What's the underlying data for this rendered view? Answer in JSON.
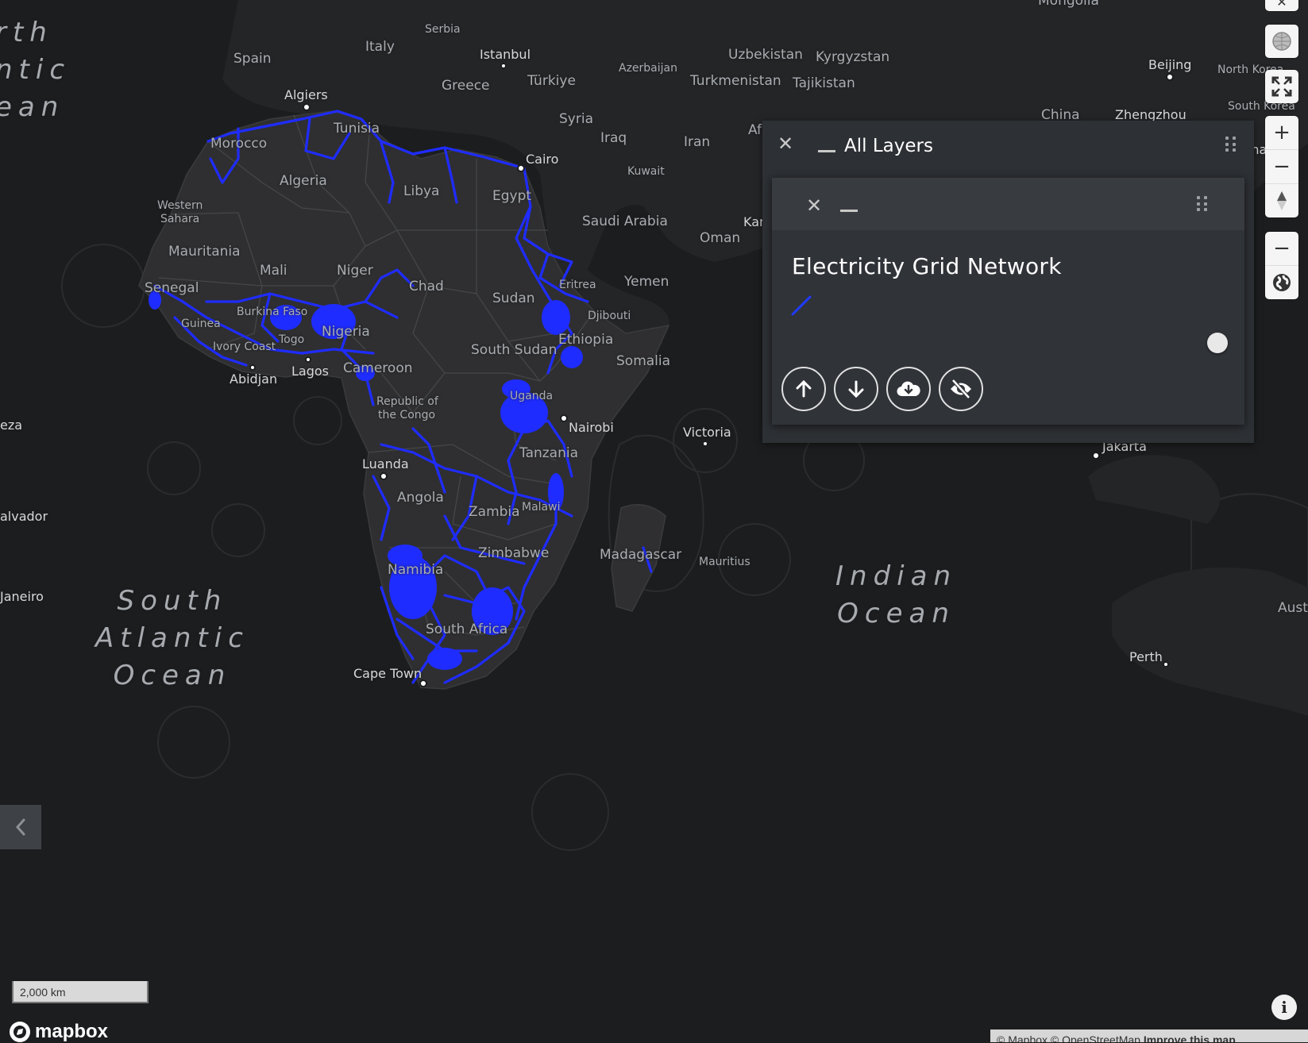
{
  "map": {
    "oceans": [
      {
        "id": "north-atlantic",
        "lines": [
          "rth",
          "ntic",
          "ean"
        ]
      },
      {
        "id": "south-atlantic",
        "lines": [
          "South",
          "Atlantic",
          "Ocean"
        ]
      },
      {
        "id": "indian",
        "lines": [
          "Indian",
          "Ocean"
        ]
      }
    ],
    "country_labels": [
      "Spain",
      "Italy",
      "Serbia",
      "Morocco",
      "Tunisia",
      "Algeria",
      "Libya",
      "Egypt",
      "Western",
      "Sahara",
      "Mauritania",
      "Mali",
      "Niger",
      "Chad",
      "Sudan",
      "Senegal",
      "Burkina Faso",
      "Guinea",
      "Ivory Coast",
      "Togo",
      "Nigeria",
      "Cameroon",
      "South Sudan",
      "Ethiopia",
      "Eritrea",
      "Djibouti",
      "Somalia",
      "Republic of",
      "the Congo",
      "Uganda",
      "Tanzania",
      "Angola",
      "Zambia",
      "Malawi",
      "Zimbabwe",
      "Namibia",
      "South Africa",
      "Madagascar",
      "Mauritius",
      "Greece",
      "Türkiye",
      "Syria",
      "Iraq",
      "Iran",
      "Kuwait",
      "Saudi Arabia",
      "Oman",
      "Yemen",
      "Azerbaijan",
      "Uzbekistan",
      "Kyrgyzstan",
      "Turkmenistan",
      "Tajikistan",
      "Afghanistan",
      "China",
      "Mongolia",
      "North Korea",
      "South Korea",
      "Aust"
    ],
    "city_labels": [
      "Istanbul",
      "Algiers",
      "Cairo",
      "Abidjan",
      "Lagos",
      "Nairobi",
      "Luanda",
      "Cape Town",
      "Victoria",
      "Beijing",
      "Zhengzhou",
      "Shangha",
      "Jakarta",
      "Perth",
      "Kara",
      "eza",
      "alvador",
      "Janeiro"
    ]
  },
  "panel": {
    "title": "All Layers",
    "layer": {
      "name": "Electricity Grid Network",
      "line_color": "#1f3bff",
      "visible": false
    }
  },
  "buttons": {
    "move_up": "arrow-up-icon",
    "move_down": "arrow-down-icon",
    "download": "cloud-download-icon",
    "hide": "eye-off-icon"
  },
  "scale": {
    "label": "2,000 km"
  },
  "logo": {
    "text": "mapbox"
  },
  "attribution": {
    "text": "© Mapbox © OpenStreetMap",
    "link": "Improve this map"
  },
  "colors": {
    "land": "#2f2f31",
    "water": "#1c1d1f",
    "grid": "#1f2cff",
    "panel": "#2d3034"
  }
}
